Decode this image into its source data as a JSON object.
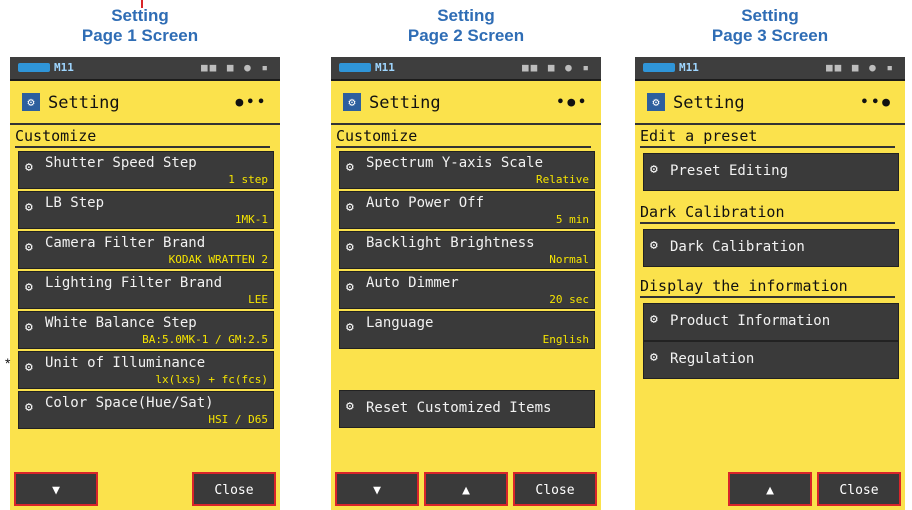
{
  "panels": [
    {
      "caption_line1": "Setting",
      "caption_line2": "Page 1 Screen",
      "status_mem": "M11",
      "title": "Setting",
      "page_indicator": "●••",
      "section": "Customize",
      "items": [
        {
          "label": "Shutter Speed Step",
          "value": "1 step"
        },
        {
          "label": "LB Step",
          "value": "1MK-1"
        },
        {
          "label": "Camera Filter Brand",
          "value": "KODAK WRATTEN 2"
        },
        {
          "label": "Lighting Filter Brand",
          "value": "LEE"
        },
        {
          "label": "White Balance Step",
          "value": "BA:5.0MK-1 / GM:2.5"
        },
        {
          "label": "Unit of Illuminance",
          "value": "lx(lxs) + fc(fcs)"
        },
        {
          "label": "Color Space(Hue/Sat)",
          "value": "HSI / D65"
        }
      ],
      "buttons": {
        "down": "▼",
        "close": "Close"
      }
    },
    {
      "caption_line1": "Setting",
      "caption_line2": "Page 2 Screen",
      "status_mem": "M11",
      "title": "Setting",
      "page_indicator": "•●•",
      "section": "Customize",
      "items": [
        {
          "label": "Spectrum Y-axis Scale",
          "value": "Relative"
        },
        {
          "label": "Auto Power Off",
          "value": "5 min"
        },
        {
          "label": "Backlight Brightness",
          "value": "Normal"
        },
        {
          "label": "Auto Dimmer",
          "value": "20 sec"
        },
        {
          "label": "Language",
          "value": "English"
        }
      ],
      "reset_label": "Reset Customized Items",
      "buttons": {
        "down": "▼",
        "up": "▲",
        "close": "Close"
      }
    },
    {
      "caption_line1": "Setting",
      "caption_line2": "Page 3 Screen",
      "status_mem": "M11",
      "title": "Setting",
      "page_indicator": "••●",
      "sections": [
        "Edit a preset",
        "Dark Calibration",
        "Display the information"
      ],
      "items": [
        {
          "label": "Preset Editing"
        },
        {
          "label": "Dark Calibration"
        },
        {
          "label": "Product Information"
        },
        {
          "label": "Regulation"
        }
      ],
      "buttons": {
        "up": "▲",
        "close": "Close"
      }
    }
  ],
  "footnote_marker": "*",
  "icons": {
    "gear": "gear-icon",
    "settings": "settings-icon",
    "battery": "battery-icon"
  },
  "colors": {
    "screen_bg": "#fbe24c",
    "button_bg": "#3a3a3a",
    "caption": "#2f6db5",
    "highlight": "#d9252a",
    "value_text": "#f5e400"
  }
}
